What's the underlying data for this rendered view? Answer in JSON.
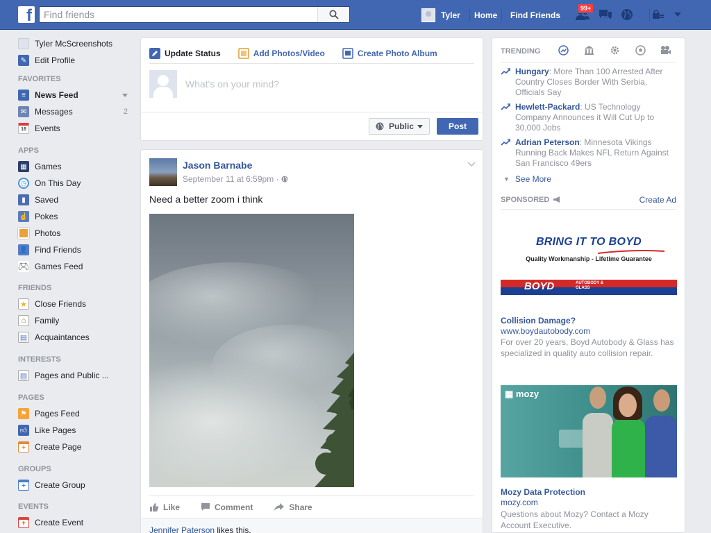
{
  "topbar": {
    "logo_letter": "f",
    "search_placeholder": "Find friends",
    "user_name": "Tyler",
    "home_label": "Home",
    "find_friends_label": "Find Friends",
    "friend_requests_badge": "99+"
  },
  "sidebar": {
    "profile_name": "Tyler McScreenshots",
    "edit_profile": "Edit Profile",
    "favorites_header": "FAVORITES",
    "news_feed": "News Feed",
    "messages": "Messages",
    "messages_count": "2",
    "events": "Events",
    "events_icon_day": "16",
    "apps_header": "APPS",
    "games": "Games",
    "on_this_day": "On This Day",
    "saved": "Saved",
    "pokes": "Pokes",
    "photos": "Photos",
    "find_friends": "Find Friends",
    "games_feed": "Games Feed",
    "friends_header": "FRIENDS",
    "close_friends": "Close Friends",
    "family": "Family",
    "acquaintances": "Acquaintances",
    "interests_header": "INTERESTS",
    "pages_and_public": "Pages and Public ...",
    "pages_header": "PAGES",
    "pages_feed": "Pages Feed",
    "like_pages": "Like Pages",
    "create_page": "Create Page",
    "groups_header": "GROUPS",
    "create_group": "Create Group",
    "events_header": "EVENTS",
    "create_event": "Create Event"
  },
  "composer": {
    "tab_update_status": "Update Status",
    "tab_add_photos": "Add Photos/Video",
    "tab_create_album": "Create Photo Album",
    "placeholder": "What's on your mind?",
    "audience": "Public",
    "post_button": "Post"
  },
  "post": {
    "author": "Jason Barnabe",
    "timestamp": "September 11 at 6:59pm · ",
    "text": "Need a better zoom i think",
    "like": "Like",
    "comment": "Comment",
    "share": "Share",
    "liker": "Jennifer Paterson",
    "likes_suffix": " likes this."
  },
  "trending": {
    "header": "TRENDING",
    "items": [
      {
        "topic": "Hungary",
        "headline": ": More Than 100 Arrested After Country Closes Border With Serbia, Officials Say"
      },
      {
        "topic": "Hewlett-Packard",
        "headline": ": US Technology Company Announces it Will Cut Up to 30,000 Jobs"
      },
      {
        "topic": "Adrian Peterson",
        "headline": ": Minnesota Vikings Running Back Makes NFL Return Against San Francisco 49ers"
      }
    ],
    "see_more": "See More"
  },
  "sponsored": {
    "header": "SPONSORED",
    "create_ad": "Create Ad",
    "ads": [
      {
        "banner_title": "BRING IT TO BOYD",
        "banner_sub": "Quality Workmanship - Lifetime Guarantee",
        "banner_brand": "BOYD",
        "banner_brand_small": "AUTOBODY & GLASS",
        "title": "Collision Damage?",
        "url": "www.boydautobody.com",
        "description": "For over 20 years, Boyd Autobody & Glass has specialized in quality auto collision repair."
      },
      {
        "banner_logo": "mozy",
        "title": "Mozy Data Protection",
        "url": "mozy.com",
        "description": "Questions about Mozy? Contact a Mozy Account Executive."
      }
    ]
  },
  "colors": {
    "brand_blue": "#4267b2",
    "link_blue": "#365899",
    "badge_red": "#fa3e3e"
  }
}
